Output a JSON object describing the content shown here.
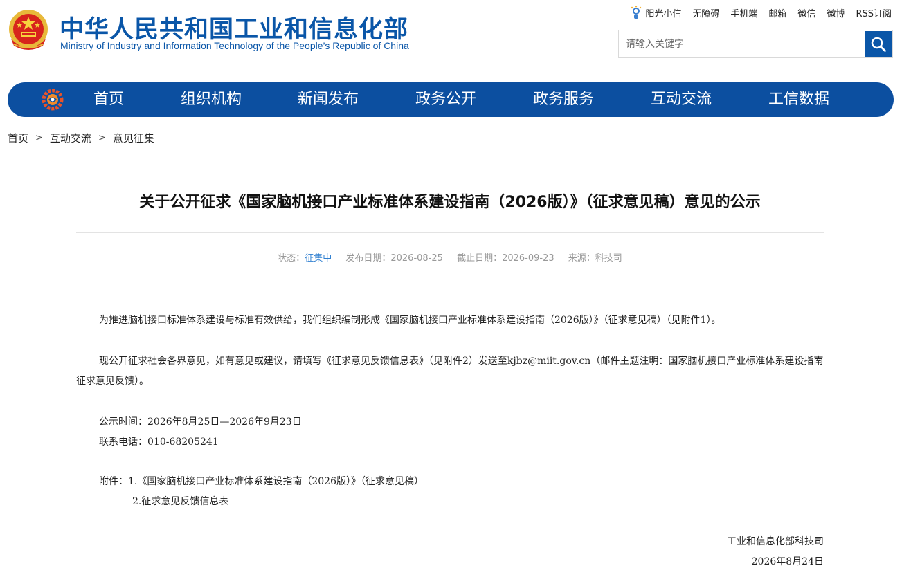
{
  "header": {
    "title": "中华人民共和国工业和信息化部",
    "subtitle": "Ministry of Industry and Information Technology of the People’s Republic of China",
    "toplinks": [
      "阳光小信",
      "无障碍",
      "手机端",
      "邮箱",
      "微信",
      "微博",
      "RSS订阅"
    ],
    "search_placeholder": "请输入关键字"
  },
  "nav": {
    "items": [
      "首页",
      "组织机构",
      "新闻发布",
      "政务公开",
      "政务服务",
      "互动交流",
      "工信数据"
    ]
  },
  "breadcrumb": {
    "items": [
      "首页",
      "互动交流",
      "意见征集"
    ],
    "separator": ">"
  },
  "article": {
    "title": "关于公开征求《国家脑机接口产业标准体系建设指南（2026版）》（征求意见稿）意见的公示",
    "meta": {
      "status_label": "状态：",
      "status_value": "征集中",
      "publish_label": "发布日期：",
      "publish_value": "2026-08-25",
      "deadline_label": "截止日期：",
      "deadline_value": "2026-09-23",
      "source_label": "来源：",
      "source_value": "科技司"
    },
    "para1": "为推进脑机接口标准体系建设与标准有效供给，我们组织编制形成《国家脑机接口产业标准体系建设指南（2026版）》（征求意见稿）（见附件1）。",
    "para2": "现公开征求社会各界意见，如有意见或建议，请填写《征求意见反馈信息表》（见附件2）发送至kjbz@miit.gov.cn（邮件主题注明：国家脑机接口产业标准体系建设指南征求意见反馈）。",
    "period": "公示时间：2026年8月25日—2026年9月23日",
    "phone": "联系电话：010-68205241",
    "attachments_label": "附件：",
    "attachment1": "1.《国家脑机接口产业标准体系建设指南（2026版）》（征求意见稿）",
    "attachment2": "2.征求意见反馈信息表",
    "signature": "工业和信息化部科技司",
    "date": "2026年8月24日"
  },
  "colors": {
    "brand_blue": "#0a56a8",
    "nav_blue": "#0c4fa0",
    "status_blue": "#2f7fd0"
  }
}
